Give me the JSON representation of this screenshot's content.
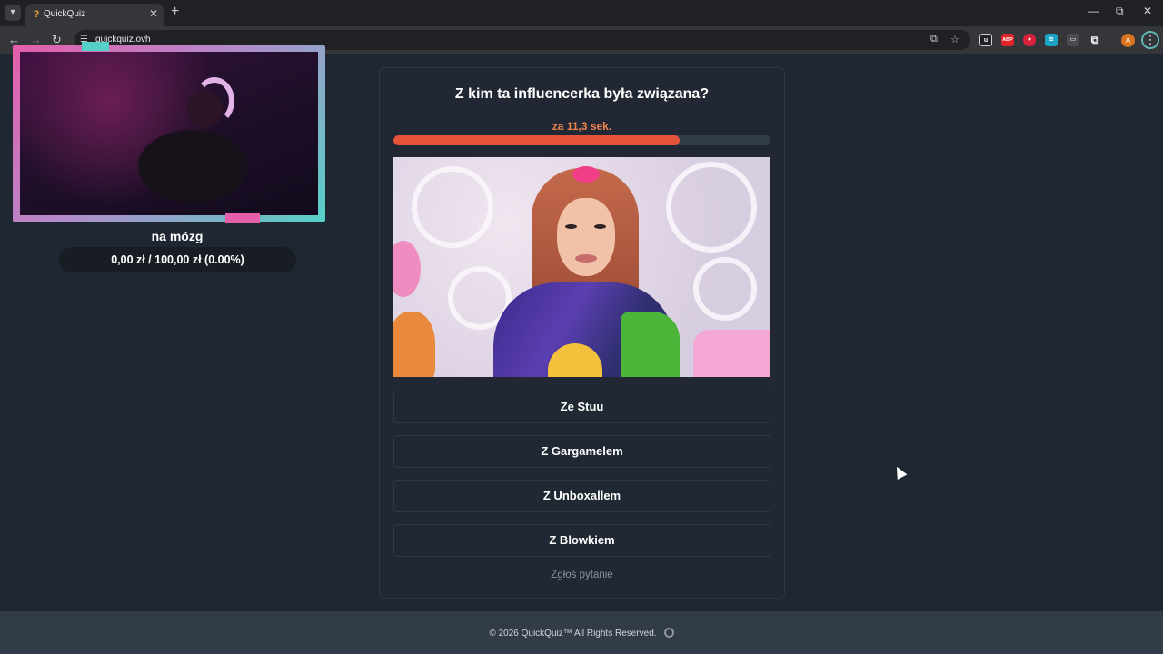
{
  "browser": {
    "tab_title": "QuickQuiz",
    "tab_favicon": "?",
    "tab_close": "✕",
    "new_tab": "+",
    "url": "quickquiz.ovh",
    "window_controls": {
      "minimize": "—",
      "restore": "⧉",
      "close": "✕"
    },
    "nav": {
      "back": "←",
      "forward": "→",
      "reload": "↻"
    },
    "icons": {
      "translate": "⧉",
      "bookmark": "☆"
    },
    "extensions": [
      {
        "name": "ublock-icon",
        "label": "u",
        "color": "#202124"
      },
      {
        "name": "adblock-plus-icon",
        "label": "ABP",
        "color": "#e0242c"
      },
      {
        "name": "red-extension-icon",
        "label": "●",
        "color": "#d9223a"
      },
      {
        "name": "teal-extension-icon",
        "label": "≋",
        "color": "#1aa3c4"
      },
      {
        "name": "grey-extension-icon",
        "label": "▭",
        "color": "#4b4c50"
      },
      {
        "name": "puzzle-icon",
        "label": "⧉",
        "color": "#35363a"
      }
    ],
    "profile_initial": "A",
    "menu": "⋮"
  },
  "stream": {
    "streamer_name": "na mózg",
    "goal": "0,00 zł / 100,00 zł (0.00%)"
  },
  "quiz": {
    "question": "Z kim ta influencerka była związana?",
    "timer": "za 11,3 sek.",
    "progress_fraction": 0.76,
    "answers": [
      "Ze Stuu",
      "Z Gargamelem",
      "Z Unboxallem",
      "Z Blowkiem"
    ],
    "report_label": "Zgłoś pytanie"
  },
  "footer": {
    "text": "© 2026  QuickQuiz™ All Rights Reserved."
  }
}
